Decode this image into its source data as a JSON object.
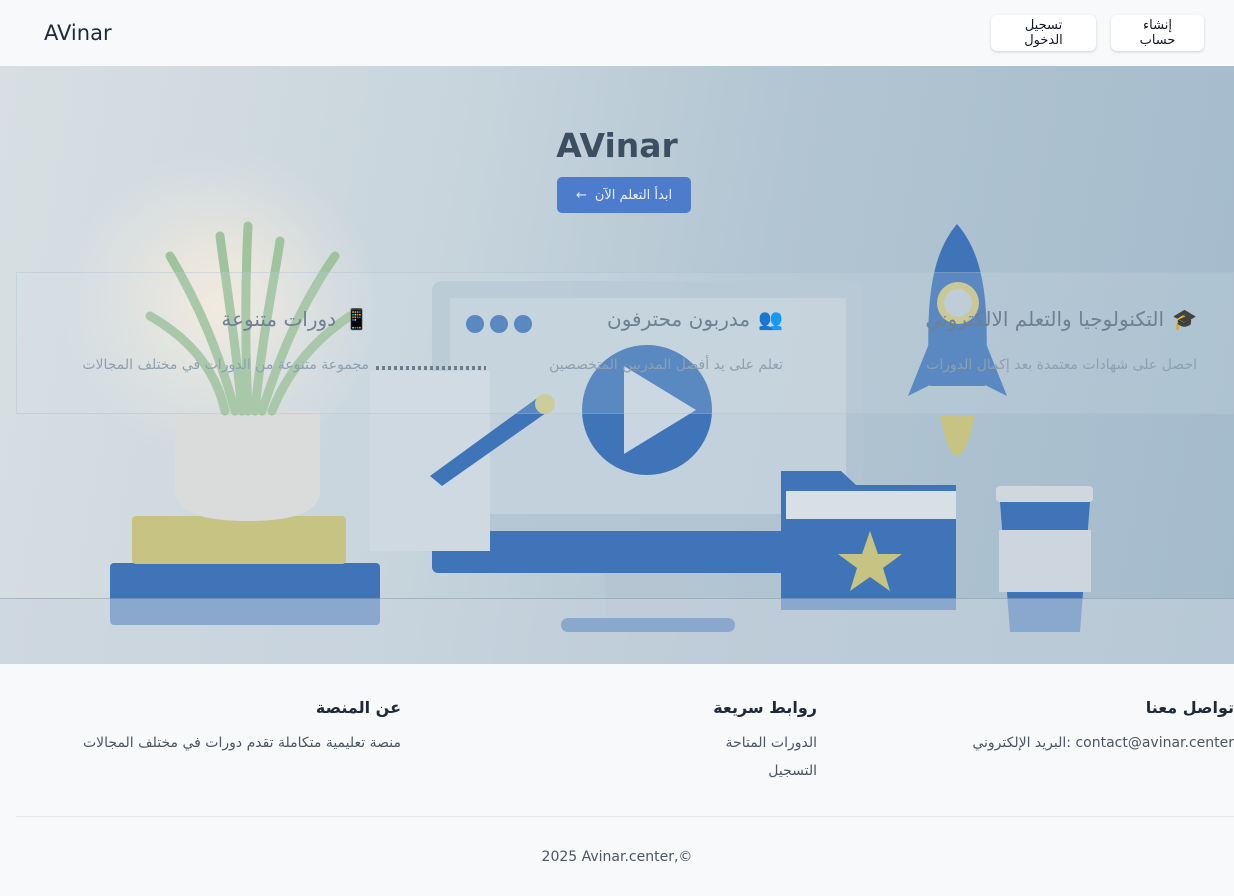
{
  "header": {
    "brand": "AVinar",
    "signup_label": "إنشاء حساب",
    "login_label": "تسجيل الدخول"
  },
  "hero": {
    "title": "AVinar",
    "cta_label": "ابدأ التعلم الآن",
    "features": [
      {
        "icon": "graduation-cap-icon",
        "title": "التكنولوجيا والتعلم الالكتروني",
        "description": "احصل على شهادات معتمدة بعد إكمال الدورات"
      },
      {
        "icon": "users-icon",
        "title": "مدربون محترفون",
        "description": "تعلم على يد أفضل المدربين المتخصصين"
      },
      {
        "icon": "book-icon",
        "title": "دورات متنوعة",
        "description": "مجموعة متنوعة من الدورات في مختلف المجالات"
      }
    ]
  },
  "footer": {
    "contact": {
      "heading": "تواصل معنا",
      "email_line": "contact@avinar.center :البريد الإلكتروني"
    },
    "links": {
      "heading": "روابط سريعة",
      "items": [
        "الدورات المتاحة",
        "التسجيل"
      ]
    },
    "about": {
      "heading": "عن المنصة",
      "text": "منصة تعليمية متكاملة تقدم دورات في مختلف المجالات"
    },
    "copyright": "2025 Avinar.center,©"
  },
  "colors": {
    "accent": "#4d7ccc",
    "hero_blue": "#3f74b8",
    "page_bg": "#f7f9fb"
  }
}
